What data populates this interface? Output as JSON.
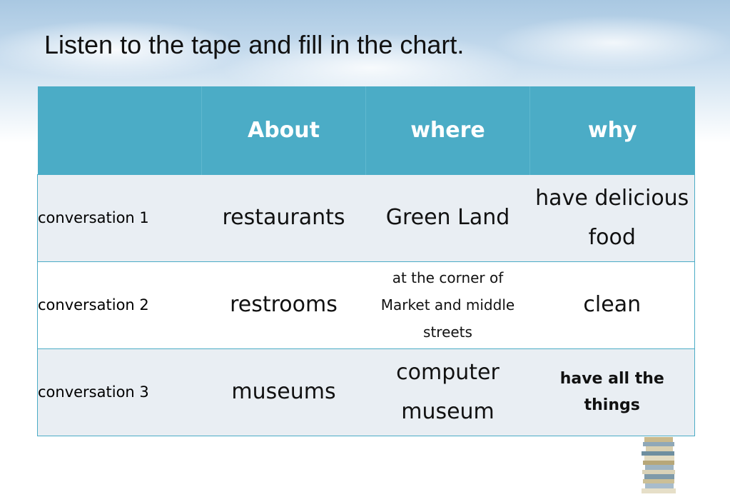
{
  "slide": {
    "title": "Listen to the tape and fill in the chart."
  },
  "chart": {
    "headers": [
      "",
      "About",
      "where",
      "why"
    ],
    "rows": [
      {
        "label": "conversation 1",
        "about": "restaurants",
        "where": "Green Land",
        "why": "have delicious food"
      },
      {
        "label": "conversation 2",
        "about": "restrooms",
        "where": "at the corner of Market and middle streets",
        "why": "clean"
      },
      {
        "label": "conversation 3",
        "about": "museums",
        "where": "computer museum",
        "why": "have all the things"
      }
    ]
  },
  "decoration": {
    "header_color": "#4bacc6",
    "band_color": "#e9eef3",
    "icon": "book-stack-icon"
  }
}
